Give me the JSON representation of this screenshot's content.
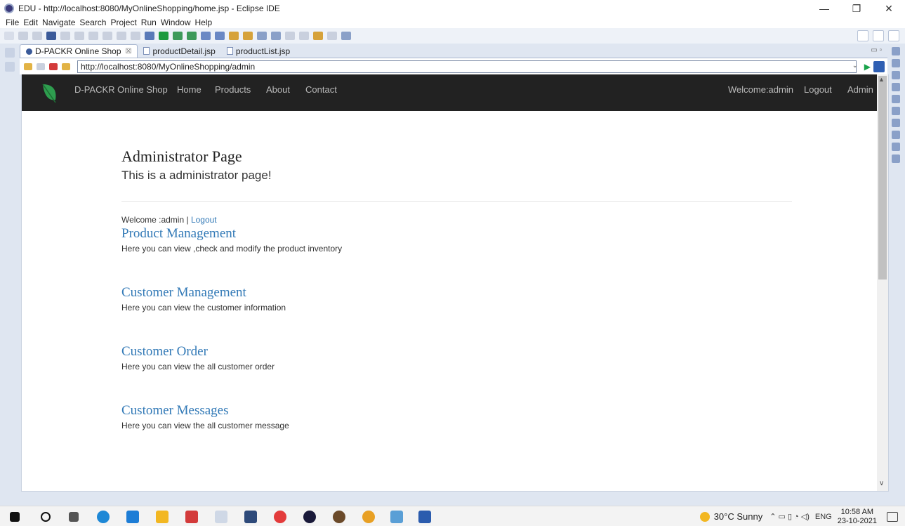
{
  "window": {
    "title": "EDU - http://localhost:8080/MyOnlineShopping/home.jsp - Eclipse IDE",
    "minimize": "—",
    "maximize": "❐",
    "close": "✕"
  },
  "menu": [
    "File",
    "Edit",
    "Navigate",
    "Search",
    "Project",
    "Run",
    "Window",
    "Help"
  ],
  "editor_tabs": [
    {
      "label": "D-PACKR Online Shop",
      "close": "☒"
    },
    {
      "label": "productDetail.jsp"
    },
    {
      "label": "productList.jsp"
    }
  ],
  "browser": {
    "url": "http://localhost:8080/MyOnlineShopping/admin"
  },
  "navbar": {
    "brand": "D-PACKR Online Shop",
    "links": [
      "Home",
      "Products",
      "About",
      "Contact"
    ],
    "welcome": "Welcome:admin",
    "logout": "Logout",
    "admin": "Admin"
  },
  "page": {
    "heading": "Administrator Page",
    "subheading": "This is a administrator page!",
    "welcome_prefix": "Welcome :admin | ",
    "welcome_logout": "Logout",
    "sections": [
      {
        "title": "Product Management",
        "desc": "Here you can view ,check and modify the product inventory"
      },
      {
        "title": "Customer Management",
        "desc": "Here you can view the customer information"
      },
      {
        "title": "Customer Order",
        "desc": "Here you can view the all customer order"
      },
      {
        "title": "Customer Messages",
        "desc": "Here you can view the all customer message"
      }
    ]
  },
  "taskbar": {
    "weather": "30°C Sunny",
    "lang": "ENG",
    "time": "10:58 AM",
    "date": "23-10-2021"
  },
  "colors": {
    "navbar_bg": "#222222",
    "link": "#337ab7",
    "leaf": "#2e9e4f"
  }
}
